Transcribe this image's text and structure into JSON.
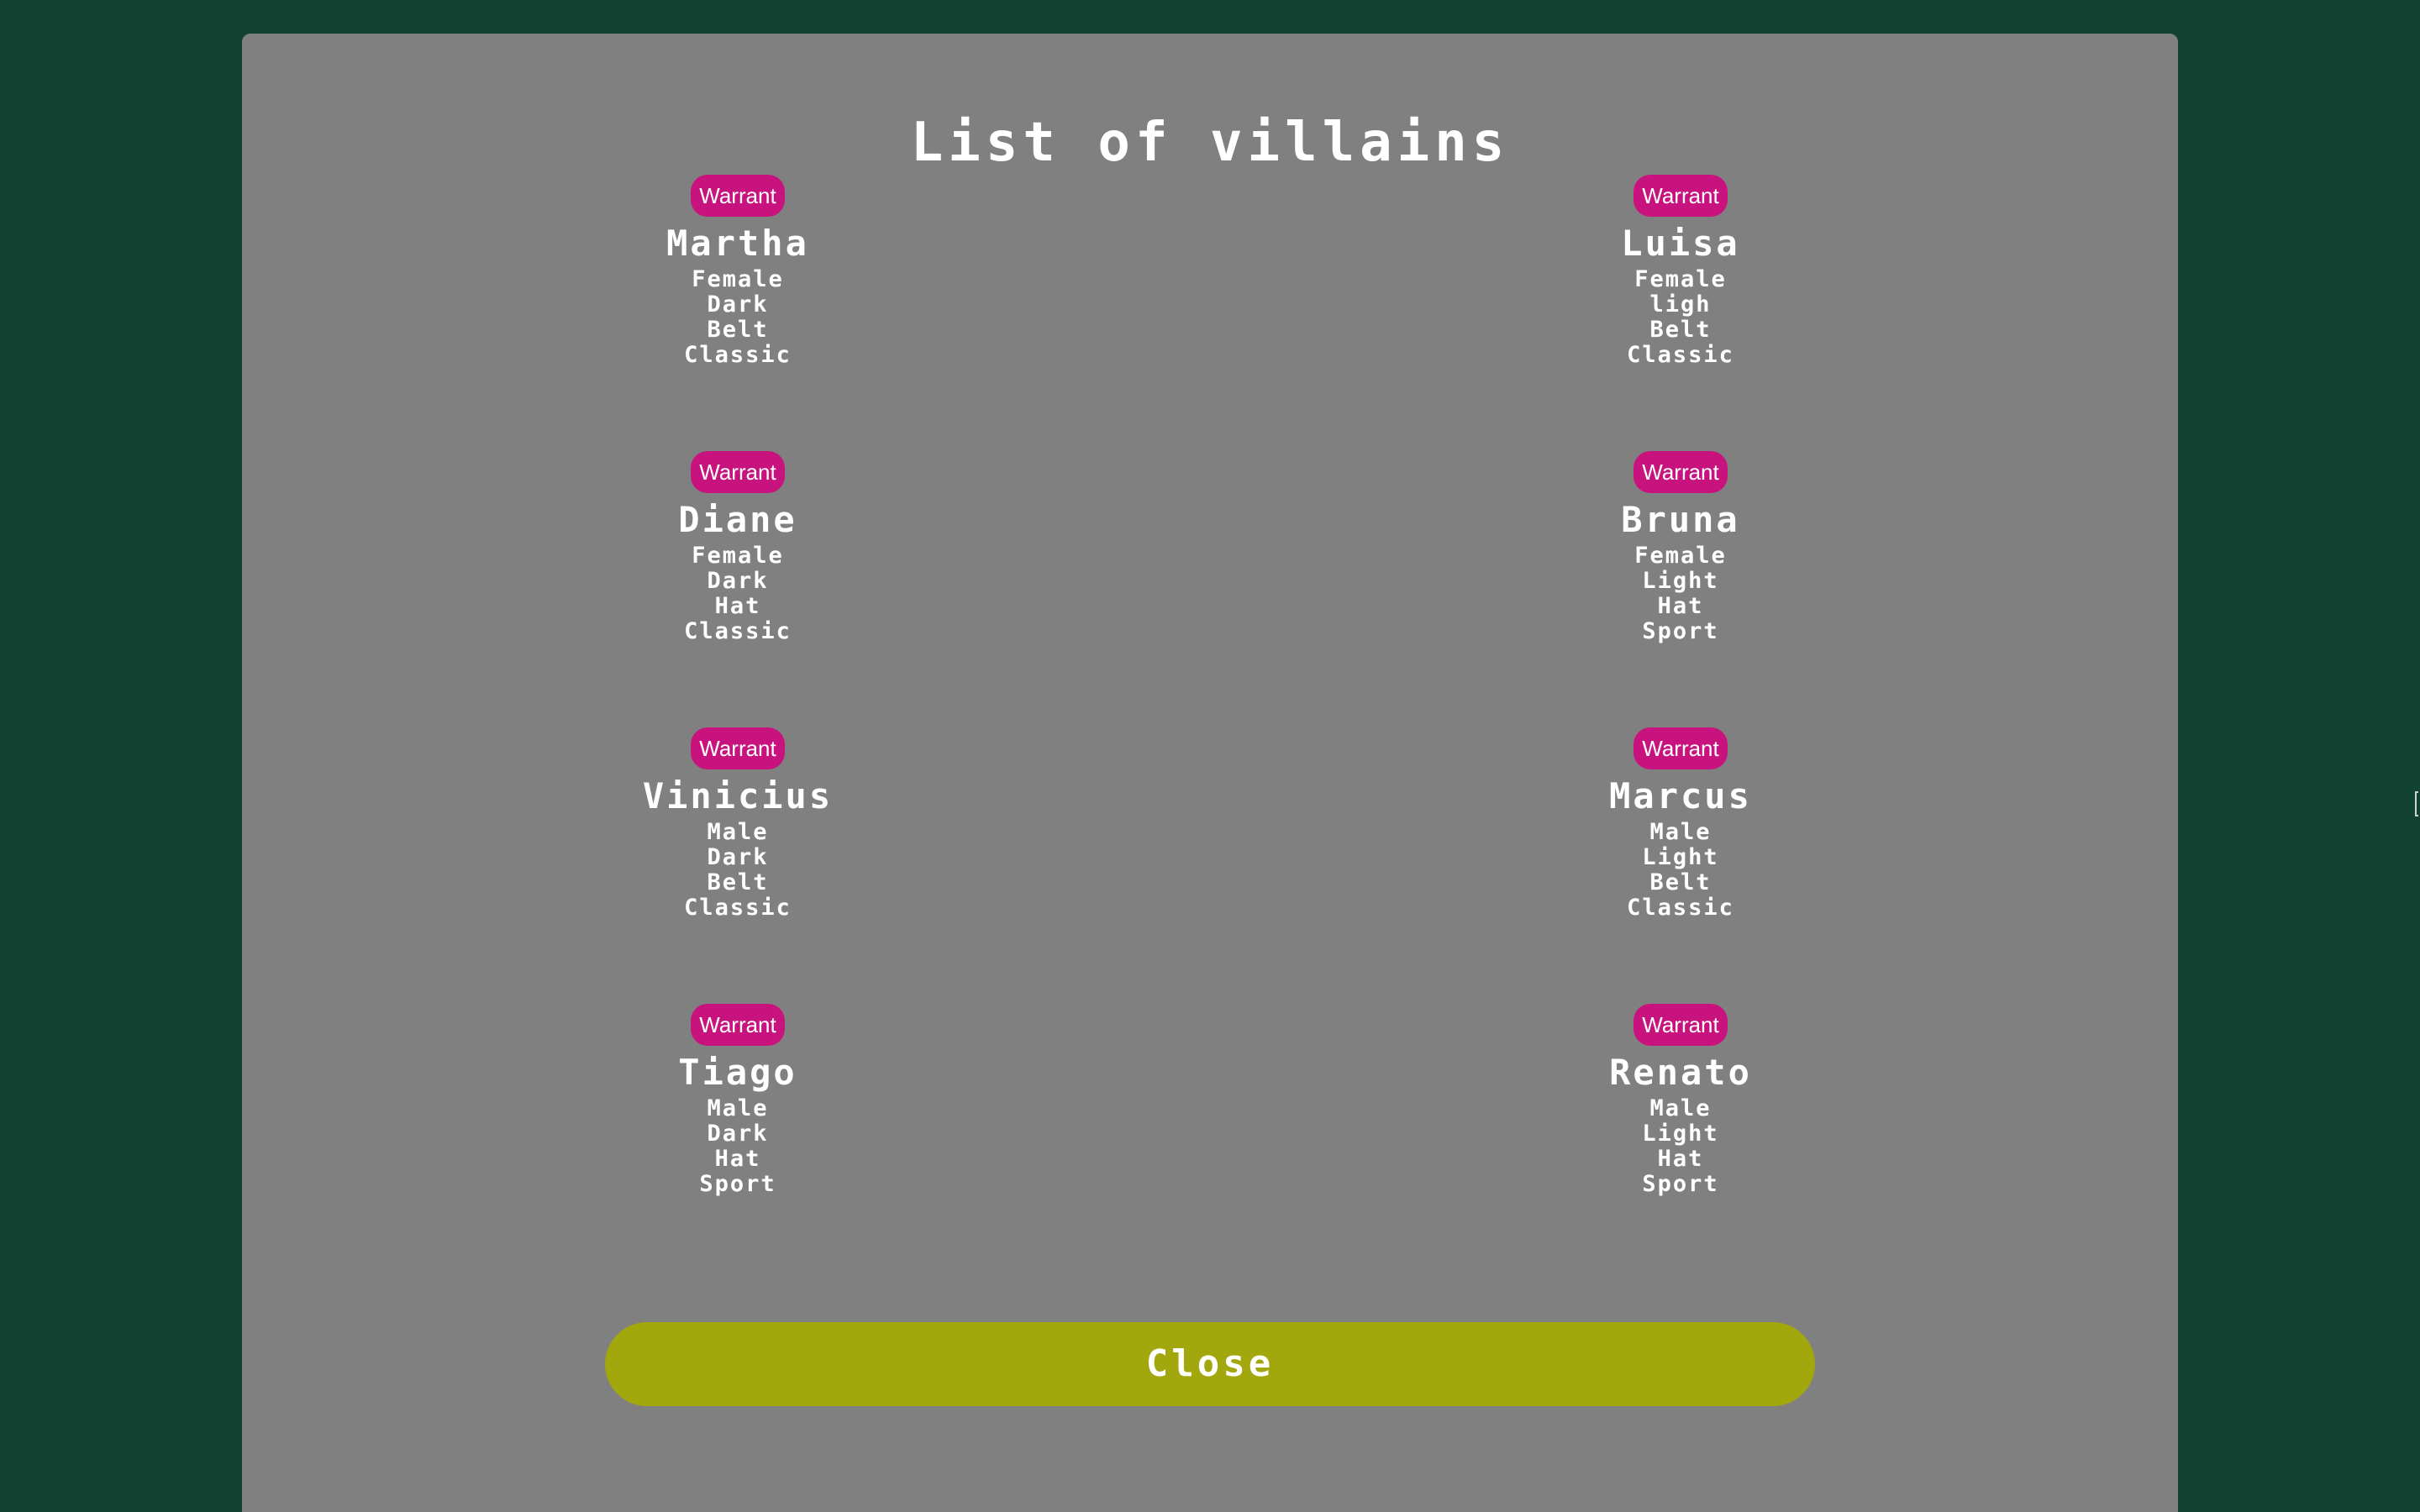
{
  "modal": {
    "title": "List of villains",
    "close_label": "Close"
  },
  "villains": [
    {
      "name": "Martha",
      "warrant_label": "Warrant",
      "attributes": [
        "Female",
        "Dark",
        "Belt",
        "Classic"
      ]
    },
    {
      "name": "Luisa",
      "warrant_label": "Warrant",
      "attributes": [
        "Female",
        "ligh",
        "Belt",
        "Classic"
      ]
    },
    {
      "name": "Diane",
      "warrant_label": "Warrant",
      "attributes": [
        "Female",
        "Dark",
        "Hat",
        "Classic"
      ]
    },
    {
      "name": "Bruna",
      "warrant_label": "Warrant",
      "attributes": [
        "Female",
        "Light",
        "Hat",
        "Sport"
      ]
    },
    {
      "name": "Vinicius",
      "warrant_label": "Warrant",
      "attributes": [
        "Male",
        "Dark",
        "Belt",
        "Classic"
      ]
    },
    {
      "name": "Marcus",
      "warrant_label": "Warrant",
      "attributes": [
        "Male",
        "Light",
        "Belt",
        "Classic"
      ]
    },
    {
      "name": "Tiago",
      "warrant_label": "Warrant",
      "attributes": [
        "Male",
        "Dark",
        "Hat",
        "Sport"
      ]
    },
    {
      "name": "Renato",
      "warrant_label": "Warrant",
      "attributes": [
        "Male",
        "Light",
        "Hat",
        "Sport"
      ]
    }
  ],
  "colors": {
    "background": "#124232",
    "modal": "#808080",
    "warrant_button": "#c8137e",
    "close_button": "#a2a70e",
    "text": "#ffffff"
  }
}
